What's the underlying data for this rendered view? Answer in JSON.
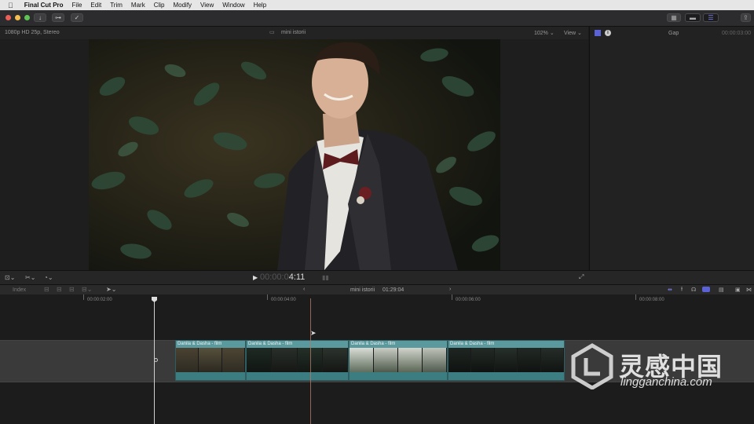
{
  "menubar": {
    "apple_icon": "apple-icon",
    "app_name": "Final Cut Pro",
    "items": [
      "File",
      "Edit",
      "Trim",
      "Mark",
      "Clip",
      "Modify",
      "View",
      "Window",
      "Help"
    ]
  },
  "toolbar": {
    "import_icon": "↓",
    "keyword_icon": "⊶",
    "check_icon": "✓"
  },
  "viewer": {
    "format": "1080p HD 25p, Stereo",
    "project": "mini istorii",
    "zoom": "102%",
    "view_label": "View"
  },
  "inspector": {
    "title": "Gap",
    "timecode": "00:00:03:00"
  },
  "transport": {
    "play_icon": "▶",
    "timecode_dim": "00:00:0",
    "timecode_bright": "4:11"
  },
  "timeline": {
    "index_label": "Index",
    "project_name": "mini istorii",
    "duration": "01:29:04",
    "ruler": [
      "00:00:02:00",
      "00:00:04:00",
      "00:00:06:00",
      "00:00:08:00"
    ],
    "clips": [
      {
        "label": "Danila & Dasha - film"
      },
      {
        "label": "Danila & Dasha - film"
      },
      {
        "label": "Danila & Dasha - film"
      },
      {
        "label": "Danila & Dasha - film"
      }
    ]
  },
  "watermark": {
    "cn": "灵感中国",
    "url": "lingganchina.com"
  },
  "colors": {
    "clip_teal": "#5a9a9e",
    "playhead": "#c8a08a",
    "accent_blue": "#5b62d6"
  }
}
